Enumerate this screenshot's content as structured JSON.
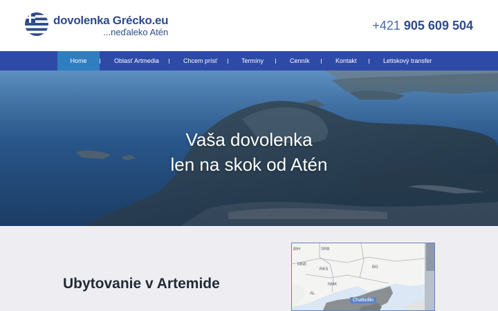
{
  "header": {
    "logo_main": "dovolenka Grécko.eu",
    "logo_sub": "...neďaleko Atén",
    "phone_prefix": "+421",
    "phone_number": "905 609 504"
  },
  "nav": {
    "items": [
      {
        "label": "Home",
        "active": true
      },
      {
        "label": "Oblasť Artmedia",
        "active": false
      },
      {
        "label": "Chcem prísť",
        "active": false
      },
      {
        "label": "Termíny",
        "active": false
      },
      {
        "label": "Cenník",
        "active": false
      },
      {
        "label": "Kontakt",
        "active": false
      },
      {
        "label": "Letiskový transfer",
        "active": false
      }
    ]
  },
  "hero": {
    "line1": "Vaša dovolenka",
    "line2": "len na skok od Atén"
  },
  "main": {
    "section_title": "Ubytovanie v Artemide"
  },
  "map": {
    "labels": [
      "BIH",
      "SRB",
      "MNE",
      "RKS",
      "BG",
      "AL",
      "NMK"
    ],
    "badge": "Chalkidiki"
  },
  "colors": {
    "brand_blue": "#2d4a8a",
    "nav_bg": "#2d4aa6",
    "nav_active": "#2f7ec0",
    "content_bg": "#eeeef2",
    "map_border": "#5b84c4"
  }
}
